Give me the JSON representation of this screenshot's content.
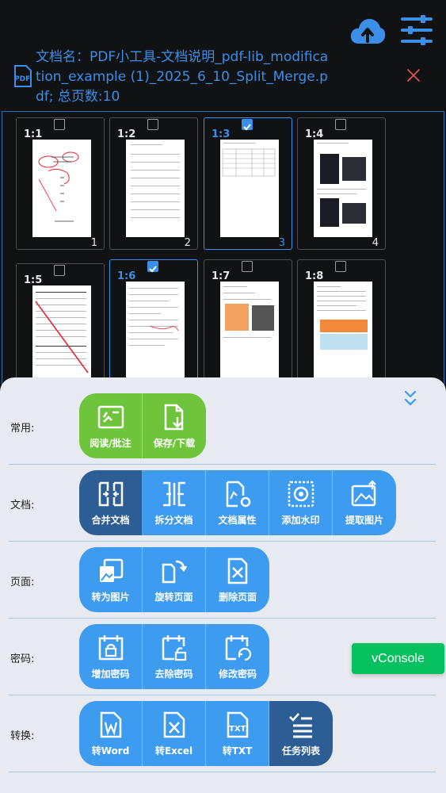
{
  "header": {
    "title": "文档名：PDF小工具-文档说明_pdf-lib_modification_example (1)_2025_6_10_Split_Merge.pdf; 总页数:10",
    "pdf_icon_label": "PDF",
    "upload_icon": "cloud-upload-icon",
    "settings_icon": "sliders-icon"
  },
  "thumbnails": [
    {
      "label": "1:1",
      "num": "1",
      "selected": false
    },
    {
      "label": "1:2",
      "num": "2",
      "selected": false
    },
    {
      "label": "1:3",
      "num": "3",
      "selected": true
    },
    {
      "label": "1:4",
      "num": "4",
      "selected": false
    },
    {
      "label": "1:5",
      "num": "",
      "selected": false
    },
    {
      "label": "1:6",
      "num": "",
      "selected": true
    },
    {
      "label": "1:7",
      "num": "",
      "selected": false
    },
    {
      "label": "1:8",
      "num": "",
      "selected": false
    }
  ],
  "rows": [
    {
      "label": "常用:",
      "buttons": [
        {
          "text": "阅读/批注",
          "icon": "annotate-icon"
        },
        {
          "text": "保存/下载",
          "icon": "save-download-icon"
        }
      ]
    },
    {
      "label": "文档:",
      "buttons": [
        {
          "text": "合并文档",
          "icon": "merge-icon"
        },
        {
          "text": "拆分文档",
          "icon": "split-icon"
        },
        {
          "text": "文档属性",
          "icon": "doc-properties-icon"
        },
        {
          "text": "添加水印",
          "icon": "watermark-icon"
        },
        {
          "text": "提取图片",
          "icon": "extract-image-icon"
        }
      ]
    },
    {
      "label": "页面:",
      "buttons": [
        {
          "text": "转为图片",
          "icon": "to-image-icon"
        },
        {
          "text": "旋转页面",
          "icon": "rotate-page-icon"
        },
        {
          "text": "删除页面",
          "icon": "delete-page-icon"
        }
      ]
    },
    {
      "label": "密码:",
      "buttons": [
        {
          "text": "增加密码",
          "icon": "add-password-icon"
        },
        {
          "text": "去除密码",
          "icon": "remove-password-icon"
        },
        {
          "text": "修改密码",
          "icon": "change-password-icon"
        }
      ]
    },
    {
      "label": "转换:",
      "buttons": [
        {
          "text": "转Word",
          "icon": "word-icon"
        },
        {
          "text": "转Excel",
          "icon": "excel-icon"
        },
        {
          "text": "转TXT",
          "icon": "txt-icon"
        },
        {
          "text": "任务列表",
          "icon": "task-list-icon"
        }
      ]
    }
  ],
  "vconsole": {
    "label": "vConsole"
  },
  "colors": {
    "accent": "#3b8fe8",
    "green": "#6ec43a",
    "dark_blue": "#2c5d94",
    "vconsole": "#07c160"
  }
}
